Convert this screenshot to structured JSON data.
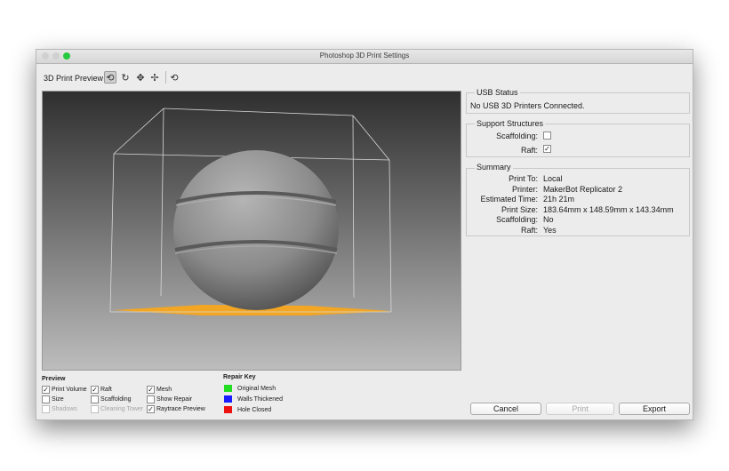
{
  "window": {
    "title": "Photoshop 3D Print Settings",
    "traffic_colors": {
      "close": "#d0d0d0",
      "minimize": "#d0d0d0",
      "zoom": "#27c93f"
    }
  },
  "toolbar": {
    "label": "3D Print Preview",
    "tools": [
      {
        "name": "orbit-icon",
        "glyph": "⟲",
        "active": true
      },
      {
        "name": "roll-icon",
        "glyph": "↻",
        "active": false
      },
      {
        "name": "pan-icon",
        "glyph": "✥",
        "active": false
      },
      {
        "name": "slide-icon",
        "glyph": "✢",
        "active": false
      }
    ],
    "reset_glyph": "⟲"
  },
  "usb_status": {
    "title": "USB Status",
    "message": "No USB 3D Printers Connected."
  },
  "support_structures": {
    "title": "Support Structures",
    "scaffolding_label": "Scaffolding:",
    "scaffolding_checked": false,
    "raft_label": "Raft:",
    "raft_checked": true
  },
  "summary": {
    "title": "Summary",
    "rows": [
      {
        "label": "Print To:",
        "value": "Local"
      },
      {
        "label": "Printer:",
        "value": "MakerBot Replicator 2"
      },
      {
        "label": "Estimated Time:",
        "value": "21h 21m"
      },
      {
        "label": "Print Size:",
        "value": "183.64mm x 148.59mm x 143.34mm"
      },
      {
        "label": "Scaffolding:",
        "value": "No"
      },
      {
        "label": "Raft:",
        "value": "Yes"
      }
    ]
  },
  "preview_options": {
    "heading": "Preview",
    "items": [
      {
        "label": "Print Volume",
        "checked": true,
        "disabled": false
      },
      {
        "label": "Size",
        "checked": false,
        "disabled": false
      },
      {
        "label": "Shadows",
        "checked": false,
        "disabled": true
      },
      {
        "label": "Raft",
        "checked": true,
        "disabled": false
      },
      {
        "label": "Scaffolding",
        "checked": false,
        "disabled": false
      },
      {
        "label": "Cleaning Tower",
        "checked": false,
        "disabled": true
      },
      {
        "label": "Mesh",
        "checked": true,
        "disabled": false
      },
      {
        "label": "Show Repair",
        "checked": false,
        "disabled": false
      },
      {
        "label": "Raytrace Preview",
        "checked": true,
        "disabled": false
      }
    ]
  },
  "repair_key": {
    "heading": "Repair Key",
    "items": [
      {
        "label": "Original Mesh",
        "color": "#22dd22"
      },
      {
        "label": "Walls Thickened",
        "color": "#1a1aff"
      },
      {
        "label": "Hole Closed",
        "color": "#ee1111"
      }
    ]
  },
  "buttons": {
    "cancel": "Cancel",
    "print": "Print",
    "export": "Export"
  },
  "colors": {
    "raft": "#f2a623",
    "sphere": "#8a8a8a"
  }
}
